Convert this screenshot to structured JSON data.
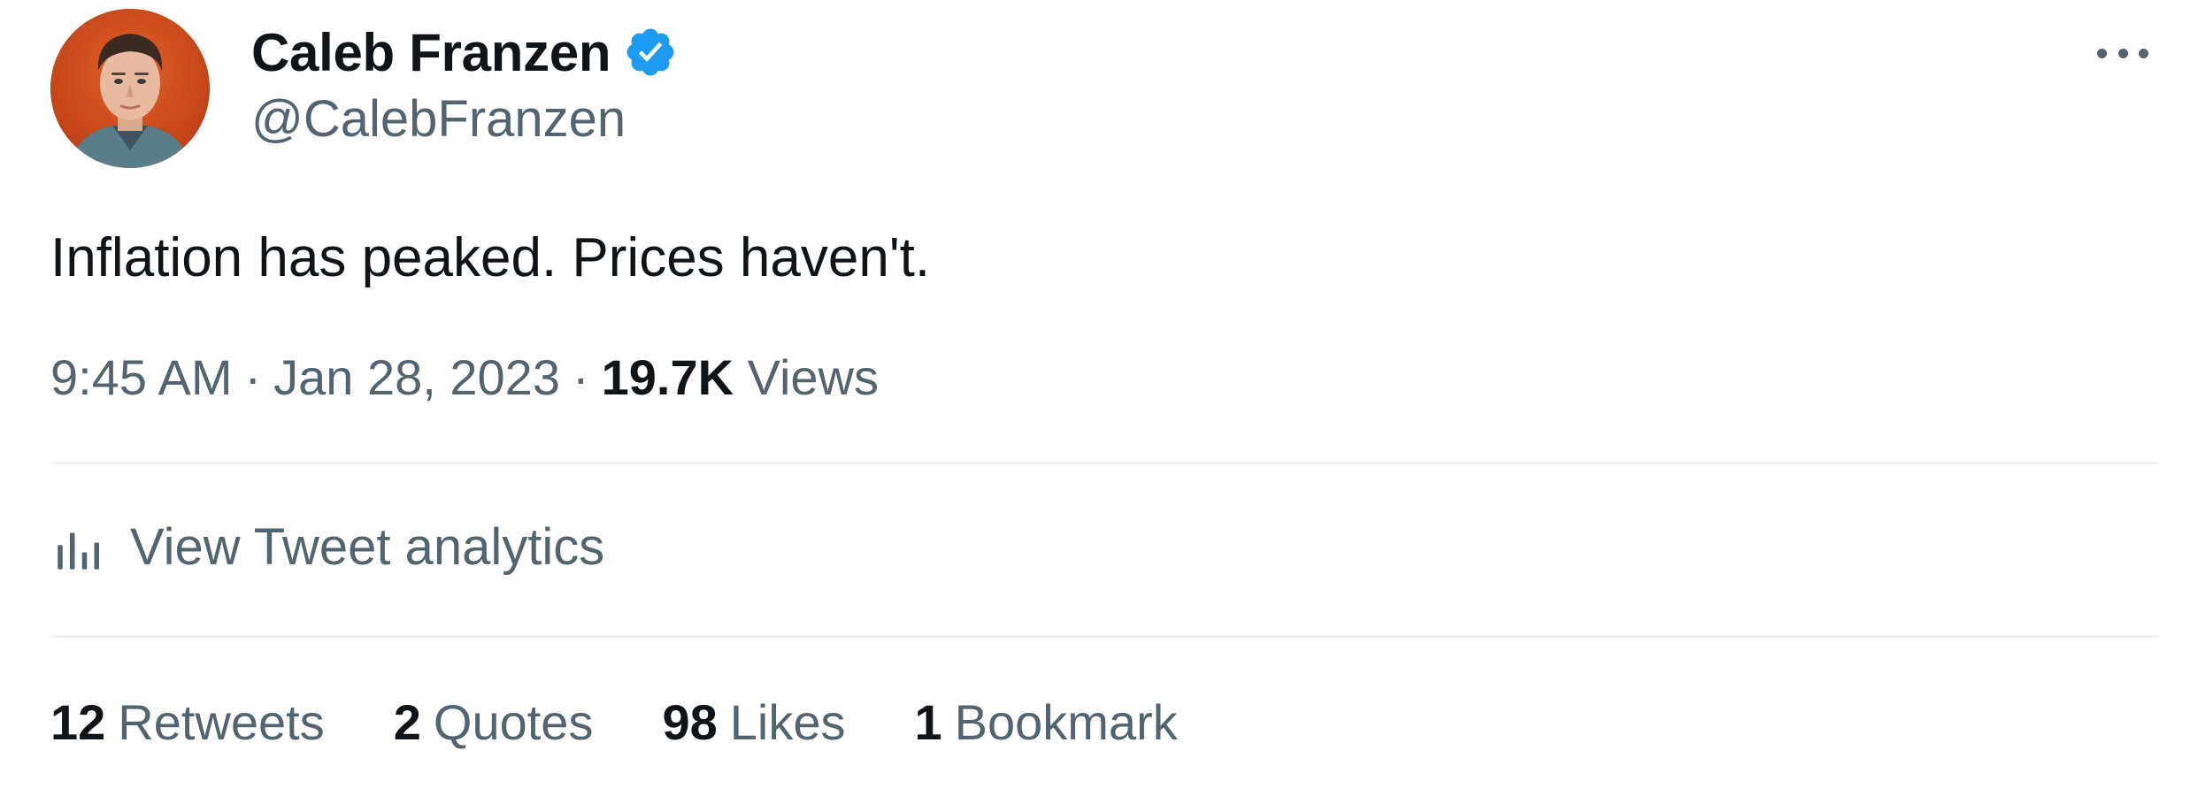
{
  "author": {
    "display_name": "Caleb Franzen",
    "handle": "@CalebFranzen",
    "verified": true,
    "verified_color": "#1d9bf0"
  },
  "tweet": {
    "text": "Inflation has peaked. Prices haven't."
  },
  "meta": {
    "time": "9:45 AM",
    "separator": "·",
    "date": "Jan 28, 2023",
    "views_count": "19.7K",
    "views_label": "Views"
  },
  "analytics": {
    "label": "View Tweet analytics",
    "icon": "bar-chart-icon"
  },
  "stats": [
    {
      "count": "12",
      "label": "Retweets"
    },
    {
      "count": "2",
      "label": "Quotes"
    },
    {
      "count": "98",
      "label": "Likes"
    },
    {
      "count": "1",
      "label": "Bookmark"
    }
  ],
  "icons": {
    "more": "more-options-icon",
    "verified": "verified-badge-icon"
  },
  "colors": {
    "text_primary": "#0f1419",
    "text_secondary": "#536471",
    "divider": "#eff3f4",
    "avatar_bg": "#c9471b"
  }
}
